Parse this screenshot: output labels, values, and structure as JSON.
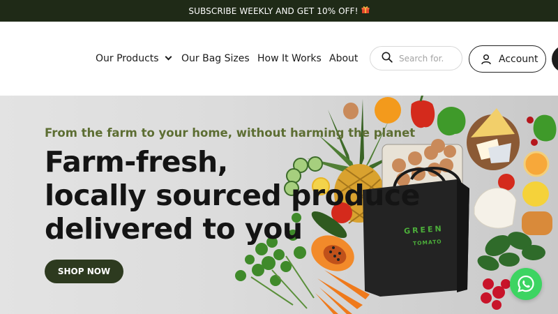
{
  "announcement": {
    "text": "SUBSCRIBE WEEKLY AND GET 10% OFF!",
    "icon": "gift-icon"
  },
  "nav": {
    "items": [
      {
        "label": "Our Products",
        "has_dropdown": true
      },
      {
        "label": "Our Bag Sizes"
      },
      {
        "label": "How It Works"
      },
      {
        "label": "About"
      }
    ]
  },
  "search": {
    "placeholder": "Search for.",
    "icon": "search-icon"
  },
  "account": {
    "label": "Account",
    "icon": "user-icon"
  },
  "hero": {
    "tagline": "From the farm to your home, without harming the planet",
    "headline": [
      "Farm-fresh,",
      "locally sourced produce",
      "delivered to you"
    ],
    "cta": "SHOP NOW"
  },
  "bag": {
    "brand_top": "GREEN",
    "brand_bottom": "TOMATO"
  },
  "chat": {
    "icon": "whatsapp-icon"
  },
  "colors": {
    "announcement_bg": "#1f2a17",
    "tagline": "#5d6e33",
    "cta_bg": "#2d3a1f",
    "whatsapp": "#3dd462"
  }
}
